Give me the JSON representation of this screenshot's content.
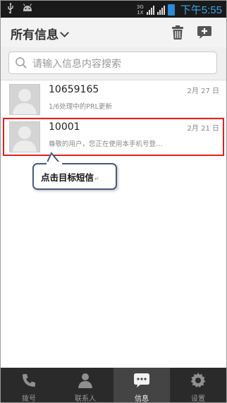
{
  "status_bar": {
    "network_top": "3G",
    "network_bottom": "1X",
    "time": "下午5:55"
  },
  "header": {
    "title": "所有信息"
  },
  "search": {
    "placeholder": "请输入信息内容搜索"
  },
  "conversations": [
    {
      "number": "10659165",
      "date": "2月 27 日",
      "snippet": "1/6处理中的PRL更新"
    },
    {
      "number": "10001",
      "date": "2月 21 日",
      "snippet": "尊敬的用户，您正在使用本手机号登…"
    }
  ],
  "annotation": {
    "text": "点击目标短信",
    "mark": "↵"
  },
  "bottom_nav": [
    {
      "label": "拨号",
      "icon": "phone-icon"
    },
    {
      "label": "联系人",
      "icon": "person-icon"
    },
    {
      "label": "信息",
      "icon": "message-icon"
    },
    {
      "label": "设置",
      "icon": "gear-icon"
    }
  ],
  "active_tab": 2,
  "colors": {
    "time": "#39a6e6",
    "highlight": "#e32020",
    "callout_border": "#455a7e"
  }
}
